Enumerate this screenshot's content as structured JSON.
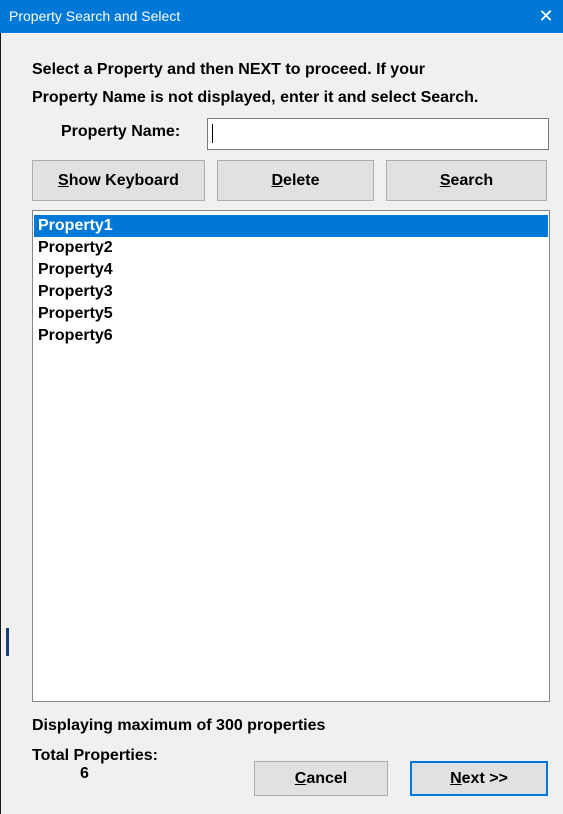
{
  "window": {
    "title": "Property Search and Select",
    "close_glyph": "✕"
  },
  "instructions": {
    "line1": "Select a Property and then NEXT to proceed. If your",
    "line2": "Property Name is not displayed, enter it and select Search."
  },
  "search": {
    "label": "Property Name:",
    "value": "",
    "placeholder": ""
  },
  "buttons": {
    "show_keyboard": {
      "accel": "S",
      "rest": "how Keyboard"
    },
    "delete": {
      "accel": "D",
      "rest": "elete"
    },
    "search": {
      "accel": "S",
      "rest": "earch"
    },
    "cancel": {
      "accel": "C",
      "rest": "ancel"
    },
    "next": {
      "accel": "N",
      "rest": "ext >>"
    }
  },
  "properties": {
    "items": [
      "Property1",
      "Property2",
      "Property4",
      "Property3",
      "Property5",
      "Property6"
    ],
    "selected_index": 0
  },
  "status": {
    "display_limit": "Displaying maximum of 300 properties",
    "total_label": "Total Properties:",
    "total_value": "6"
  },
  "colors": {
    "titlebar": "#0078d7",
    "selection": "#0078d7",
    "dialog_bg": "#f0f0f0"
  }
}
